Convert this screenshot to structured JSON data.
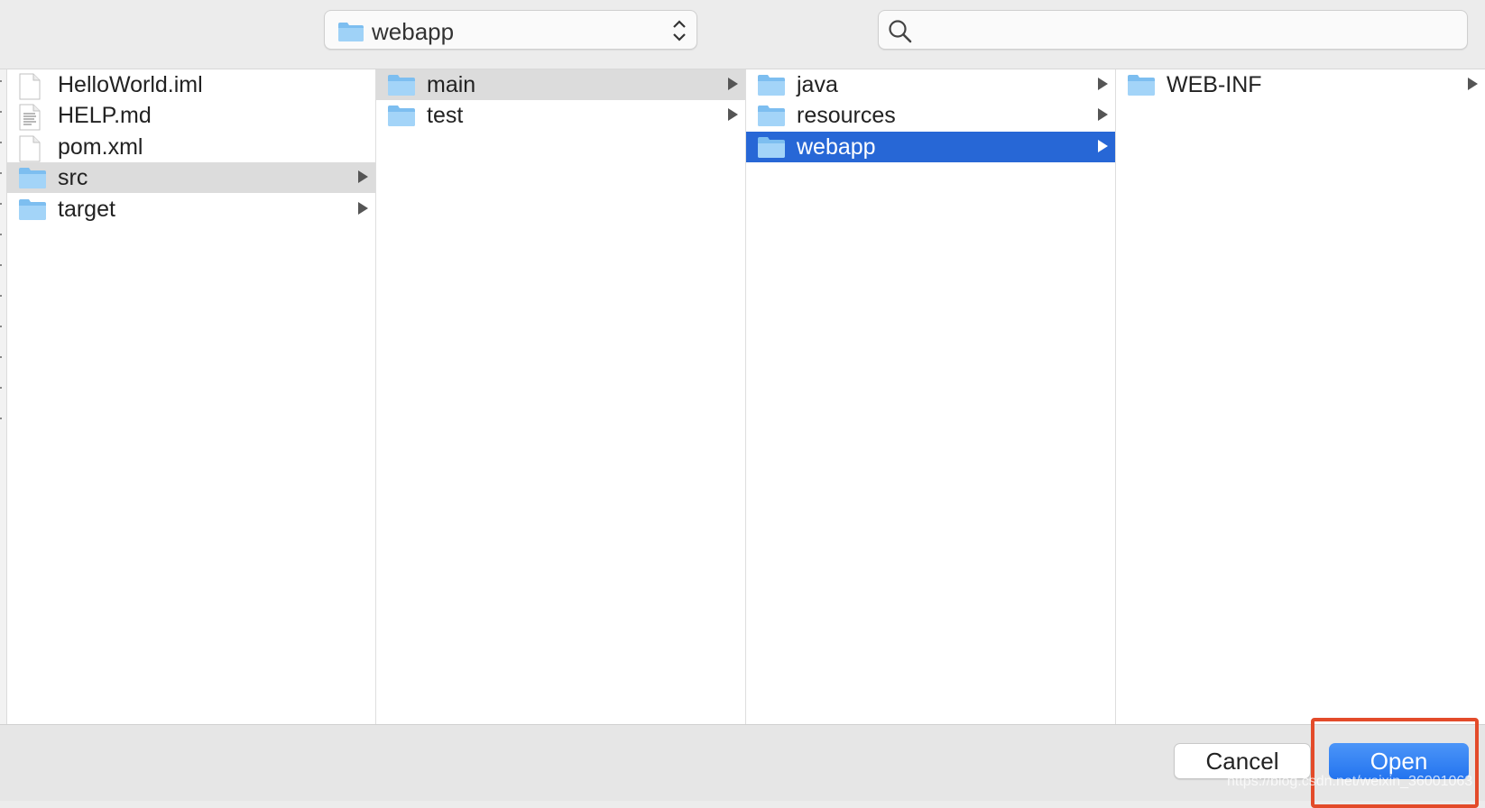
{
  "toolbar": {
    "location": "webapp",
    "search_value": "",
    "search_placeholder": ""
  },
  "columns": [
    {
      "items": [
        {
          "name": "HelloWorld.iml",
          "kind": "file",
          "icon": "file-icon",
          "state": "",
          "has_children": false
        },
        {
          "name": "HELP.md",
          "kind": "text",
          "icon": "text-file-icon",
          "state": "",
          "has_children": false
        },
        {
          "name": "pom.xml",
          "kind": "file",
          "icon": "file-icon",
          "state": "",
          "has_children": false
        },
        {
          "name": "src",
          "kind": "folder",
          "icon": "folder-icon",
          "state": "path",
          "has_children": true
        },
        {
          "name": "target",
          "kind": "folder",
          "icon": "folder-icon",
          "state": "",
          "has_children": true
        }
      ]
    },
    {
      "items": [
        {
          "name": "main",
          "kind": "folder",
          "icon": "folder-icon",
          "state": "path",
          "has_children": true
        },
        {
          "name": "test",
          "kind": "folder",
          "icon": "folder-icon",
          "state": "",
          "has_children": true
        }
      ]
    },
    {
      "items": [
        {
          "name": "java",
          "kind": "folder",
          "icon": "folder-icon",
          "state": "",
          "has_children": true
        },
        {
          "name": "resources",
          "kind": "folder",
          "icon": "folder-icon",
          "state": "",
          "has_children": true
        },
        {
          "name": "webapp",
          "kind": "folder",
          "icon": "folder-icon",
          "state": "selected",
          "has_children": true
        }
      ]
    },
    {
      "items": [
        {
          "name": "WEB-INF",
          "kind": "folder",
          "icon": "folder-icon",
          "state": "",
          "has_children": true
        }
      ]
    }
  ],
  "footer": {
    "cancel_label": "Cancel",
    "open_label": "Open",
    "watermark": "https://blog.csdn.net/weixin_36001063"
  },
  "colors": {
    "selection": "#2767d6",
    "path_highlight": "#dcdcdc",
    "open_button": "#2474ef",
    "annotation_box": "#e34b2a"
  }
}
